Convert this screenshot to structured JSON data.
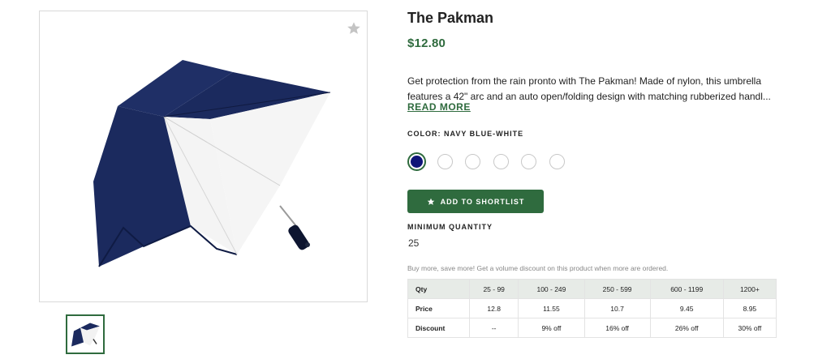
{
  "product": {
    "title": "The Pakman",
    "price": "$12.80",
    "description_line1": "Get protection from the rain pronto with The Pakman! Made of nylon, this umbrella",
    "description_line2": "features a 42\" arc and an auto open/folding design with matching rubberized handl...",
    "read_more": "READ MORE"
  },
  "color": {
    "label": "COLOR: NAVY BLUE-WHITE",
    "selected_hex": "#0f1478",
    "swatch_count": 6
  },
  "actions": {
    "shortlist_label": "ADD TO SHORTLIST"
  },
  "minimum_quantity": {
    "label": "MINIMUM QUANTITY",
    "value": "25"
  },
  "volume": {
    "note": "Buy more, save more! Get a volume discount on this product when more are ordered.",
    "header": [
      "Qty",
      "25 - 99",
      "100 - 249",
      "250 - 599",
      "600 - 1199",
      "1200+"
    ],
    "price_row": [
      "Price",
      "12.8",
      "11.55",
      "10.7",
      "9.45",
      "8.95"
    ],
    "discount_row": [
      "Discount",
      "--",
      "9% off",
      "16% off",
      "26% off",
      "30% off"
    ]
  },
  "icons": {
    "favorite": "star-icon",
    "button": "star-icon"
  },
  "colors": {
    "accent_green": "#2f6b3e",
    "navy": "#1b2a5e"
  }
}
